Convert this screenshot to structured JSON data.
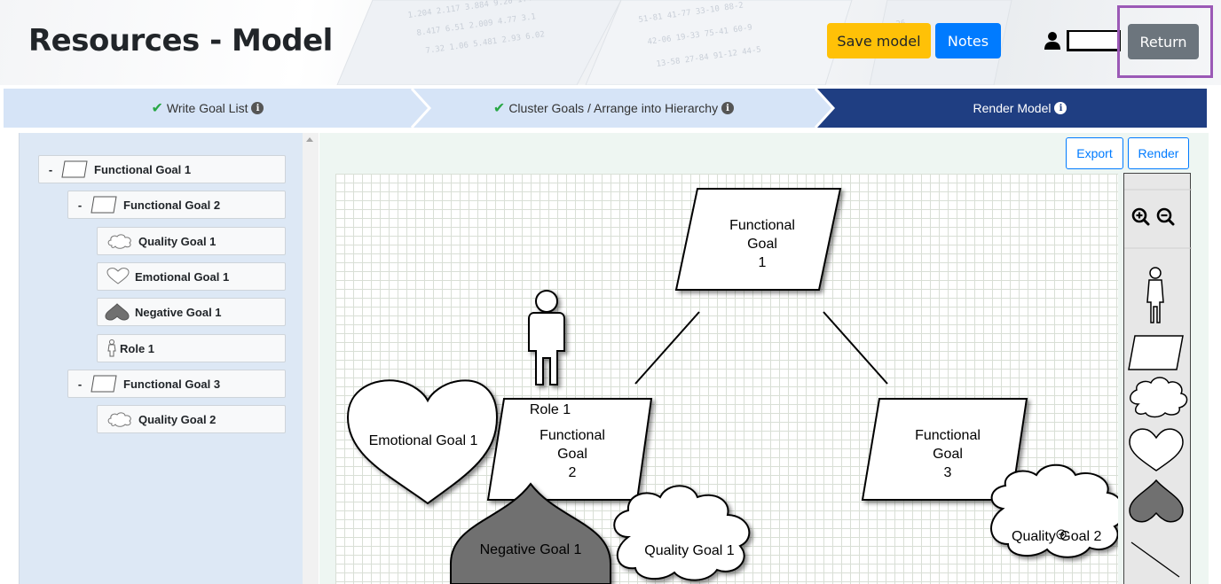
{
  "header": {
    "title": "Resources - Model",
    "save_label": "Save model",
    "notes_label": "Notes",
    "return_label": "Return",
    "user_icon": "user-icon"
  },
  "steps": [
    {
      "label": "Write Goal List",
      "done": true
    },
    {
      "label": "Cluster Goals / Arrange into Hierarchy",
      "done": true
    },
    {
      "label": "Render Model",
      "active": true
    }
  ],
  "tree": [
    {
      "label": "Functional Goal 1",
      "type": "functional",
      "collapse": "-"
    },
    {
      "label": "Functional Goal 2",
      "type": "functional",
      "collapse": "-"
    },
    {
      "label": "Quality Goal 1",
      "type": "quality"
    },
    {
      "label": "Emotional Goal 1",
      "type": "emotional"
    },
    {
      "label": "Negative Goal 1",
      "type": "negative"
    },
    {
      "label": "Role 1",
      "type": "role"
    },
    {
      "label": "Functional Goal 3",
      "type": "functional",
      "collapse": "-"
    },
    {
      "label": "Quality Goal 2",
      "type": "quality"
    }
  ],
  "toolbar": {
    "export_label": "Export",
    "render_label": "Render"
  },
  "model": {
    "fg1": {
      "line1": "Functional",
      "line2": "Goal",
      "line3": "1"
    },
    "fg2": {
      "line1": "Functional",
      "line2": "Goal",
      "line3": "2"
    },
    "fg3": {
      "line1": "Functional",
      "line2": "Goal",
      "line3": "3"
    },
    "role": "Role 1",
    "emotional": "Emotional Goal 1",
    "negative": "Negative Goal 1",
    "quality1": "Quality Goal 1",
    "quality2": "Quality Goal 2"
  },
  "palette": [
    "zoom-in-icon",
    "zoom-out-icon",
    "role-icon",
    "functional-goal-icon",
    "quality-goal-icon",
    "emotional-goal-icon",
    "negative-goal-icon",
    "connector-icon"
  ],
  "colors": {
    "save": "#ffc107",
    "notes": "#007bff",
    "return": "#6c757d",
    "step_active": "#1f3e82",
    "step_inactive": "#d6e4f7",
    "highlight": "#9b59b6"
  }
}
